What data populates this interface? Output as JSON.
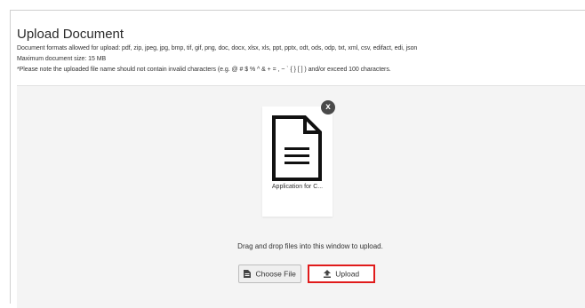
{
  "upload": {
    "title": "Upload Document",
    "formats_text": "Document formats allowed for upload: pdf, zip, jpeg, jpg, bmp, tif, gif, png, doc, docx, xlsx, xls, ppt, pptx, odt, ods, odp, txt, xml, csv, edifact, edi, json",
    "max_size_text": "Maximum document size: 15 MB",
    "note_text": "*Please note the uploaded file name should not contain invalid characters (e.g. @ # $ % ^ & + = , ~ ` { } [ ] ) and/or exceed 100 characters.",
    "file": {
      "name": "Application for C...",
      "icon": "document-icon",
      "remove_label": "x"
    },
    "drop_hint": "Drag and drop files into this window to upload.",
    "choose_file_label": "Choose File",
    "choose_file_icon": "file-icon",
    "upload_label": "Upload",
    "upload_icon": "upload-icon",
    "highlight_color": "#e01b1b"
  }
}
